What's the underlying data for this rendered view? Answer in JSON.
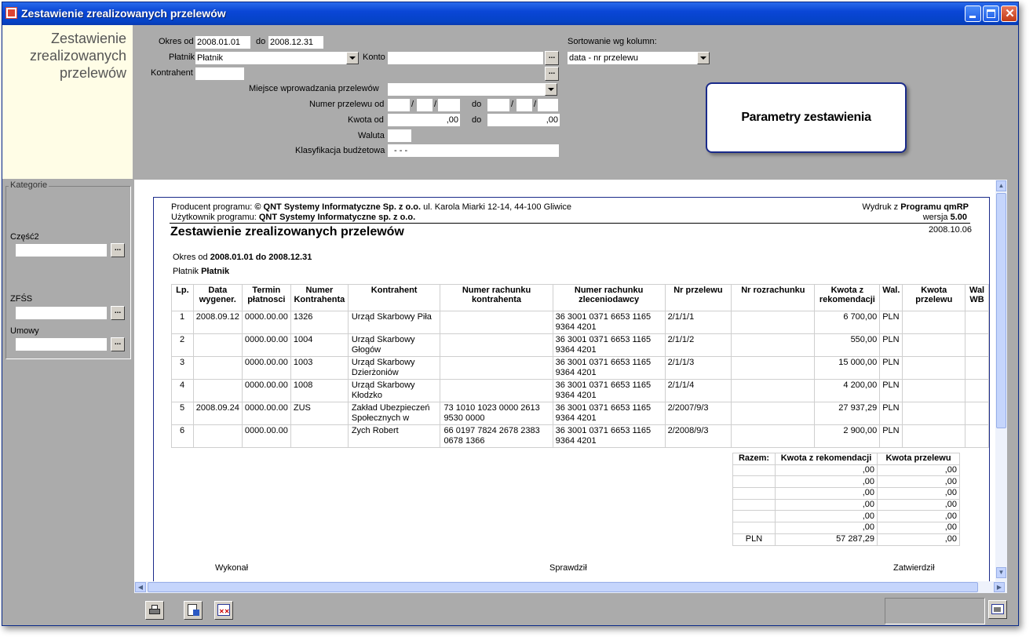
{
  "window": {
    "title": "Zestawienie zrealizowanych przelewów"
  },
  "side_title": [
    "Zestawienie",
    "zrealizowanych",
    "przelewów"
  ],
  "filters": {
    "okres_od_label": "Okres od",
    "okres_od_value": "2008.01.01",
    "do_label": "do",
    "okres_do_value": "2008.12.31",
    "platnik_label": "Płatnik",
    "platnik_value": "Płatnik",
    "konto_label": "Konto",
    "konto_value": "",
    "kontrahent_label": "Kontrahent",
    "kontrahent_value": "",
    "miejsce_label": "Miejsce wprowadzania przelewów",
    "miejsce_value": "",
    "numer_label": "Numer przelewu od",
    "numer_do_label": "do",
    "slash": "/",
    "kwota_label": "Kwota od",
    "kwota_od_value": ",00",
    "kwota_do_label": "do",
    "kwota_do_value": ",00",
    "waluta_label": "Waluta",
    "waluta_value": "",
    "klas_label": "Klasyfikacja budżetowa",
    "klas_value": "-   -   -",
    "sort_label": "Sortowanie wg kolumn:",
    "sort_value": "data - nr przelewu",
    "params_button": "Parametry zestawienia"
  },
  "categories": {
    "group_label": "Kategorie",
    "czesc2_label": "Część2",
    "zfss_label": "ZFŚS",
    "umowy_label": "Umowy",
    "dots": "..."
  },
  "report": {
    "producer_prefix": "Producent programu: ",
    "producer_name": "© QNT Systemy Informatyczne Sp. z o.o.",
    "producer_address": " ul. Karola Miarki 12-14, 44-100 Gliwice",
    "user_prefix": "Użytkownik programu: ",
    "user_name": "QNT Systemy Informatyczne sp. z o.o.",
    "printout_prefix": "Wydruk z ",
    "printout_program": "Programu  qmRP",
    "version_label": "wersja ",
    "version_value": "5.00",
    "date": "2008.10.06",
    "title": "Zestawienie zrealizowanych przelewów",
    "okres_label": "Okres od ",
    "okres_value": "2008.01.01 do 2008.12.31",
    "platnik_label": "Płatnik ",
    "platnik_value": "Płatnik",
    "columns": [
      "Lp.",
      "Data wygener.",
      "Termin płatnosci",
      "Numer Kontrahenta",
      "Kontrahent",
      "Numer rachunku kontrahenta",
      "Numer rachunku zleceniodawcy",
      "Nr przelewu",
      "Nr rozrachunku",
      "Kwota z rekomendacji",
      "Wal.",
      "Kwota przelewu",
      "Wal WB"
    ],
    "rows": [
      {
        "lp": "1",
        "data": "2008.09.12",
        "termin": "0000.00.00",
        "numer": "1326",
        "kontrahent": "Urząd Skarbowy Piła",
        "rach_k": "",
        "rach_z": "36 3001 0371 6653 1165 9364 4201",
        "nr": "2/1/1/1",
        "rozr": "",
        "kwota": "6 700,00",
        "wal": "PLN",
        "kwota_p": "",
        "walwb": ""
      },
      {
        "lp": "2",
        "data": "",
        "termin": "0000.00.00",
        "numer": "1004",
        "kontrahent": "Urząd Skarbowy Głogów",
        "rach_k": "",
        "rach_z": "36 3001 0371 6653 1165 9364 4201",
        "nr": "2/1/1/2",
        "rozr": "",
        "kwota": "550,00",
        "wal": "PLN",
        "kwota_p": "",
        "walwb": ""
      },
      {
        "lp": "3",
        "data": "",
        "termin": "0000.00.00",
        "numer": "1003",
        "kontrahent": "Urząd Skarbowy Dzierżoniów",
        "rach_k": "",
        "rach_z": "36 3001 0371 6653 1165 9364 4201",
        "nr": "2/1/1/3",
        "rozr": "",
        "kwota": "15 000,00",
        "wal": "PLN",
        "kwota_p": "",
        "walwb": ""
      },
      {
        "lp": "4",
        "data": "",
        "termin": "0000.00.00",
        "numer": "1008",
        "kontrahent": "Urząd Skarbowy Kłodzko",
        "rach_k": "",
        "rach_z": "36 3001 0371 6653 1165 9364 4201",
        "nr": "2/1/1/4",
        "rozr": "",
        "kwota": "4 200,00",
        "wal": "PLN",
        "kwota_p": "",
        "walwb": ""
      },
      {
        "lp": "5",
        "data": "2008.09.24",
        "termin": "0000.00.00",
        "numer": "ZUS",
        "kontrahent": "Zakład Ubezpieczeń Społecznych w Zabrzu",
        "rach_k": "73 1010 1023 0000 2613 9530 0000",
        "rach_z": "36 3001 0371 6653 1165 9364 4201",
        "nr": "2/2007/9/3",
        "rozr": "",
        "kwota": "27 937,29",
        "wal": "PLN",
        "kwota_p": "",
        "walwb": ""
      },
      {
        "lp": "6",
        "data": "",
        "termin": "0000.00.00",
        "numer": "",
        "kontrahent": "Zych Robert",
        "rach_k": "66 0197 7824 2678 2383 0678 1366",
        "rach_z": "36 3001 0371 6653 1165 9364 4201",
        "nr": "2/2008/9/3",
        "rozr": "",
        "kwota": "2 900,00",
        "wal": "PLN",
        "kwota_p": "",
        "walwb": ""
      }
    ],
    "summary_headers": [
      "Razem:",
      "Kwota z rekomendacji",
      "Kwota przelewu"
    ],
    "summary_rows": [
      [
        "",
        ",00",
        ",00"
      ],
      [
        "",
        ",00",
        ",00"
      ],
      [
        "",
        ",00",
        ",00"
      ],
      [
        "",
        ",00",
        ",00"
      ],
      [
        "",
        ",00",
        ",00"
      ],
      [
        "",
        ",00",
        ",00"
      ],
      [
        "PLN",
        "57 287,29",
        ",00"
      ]
    ],
    "sign_wykonal": "Wykonał",
    "sign_sprawdzil": "Sprawdził",
    "sign_zatwierdzil": "Zatwierdził"
  },
  "toolbar": {
    "print": "printer-icon",
    "export": "export-icon",
    "close": "close-report-icon",
    "extra": "window-icon"
  }
}
